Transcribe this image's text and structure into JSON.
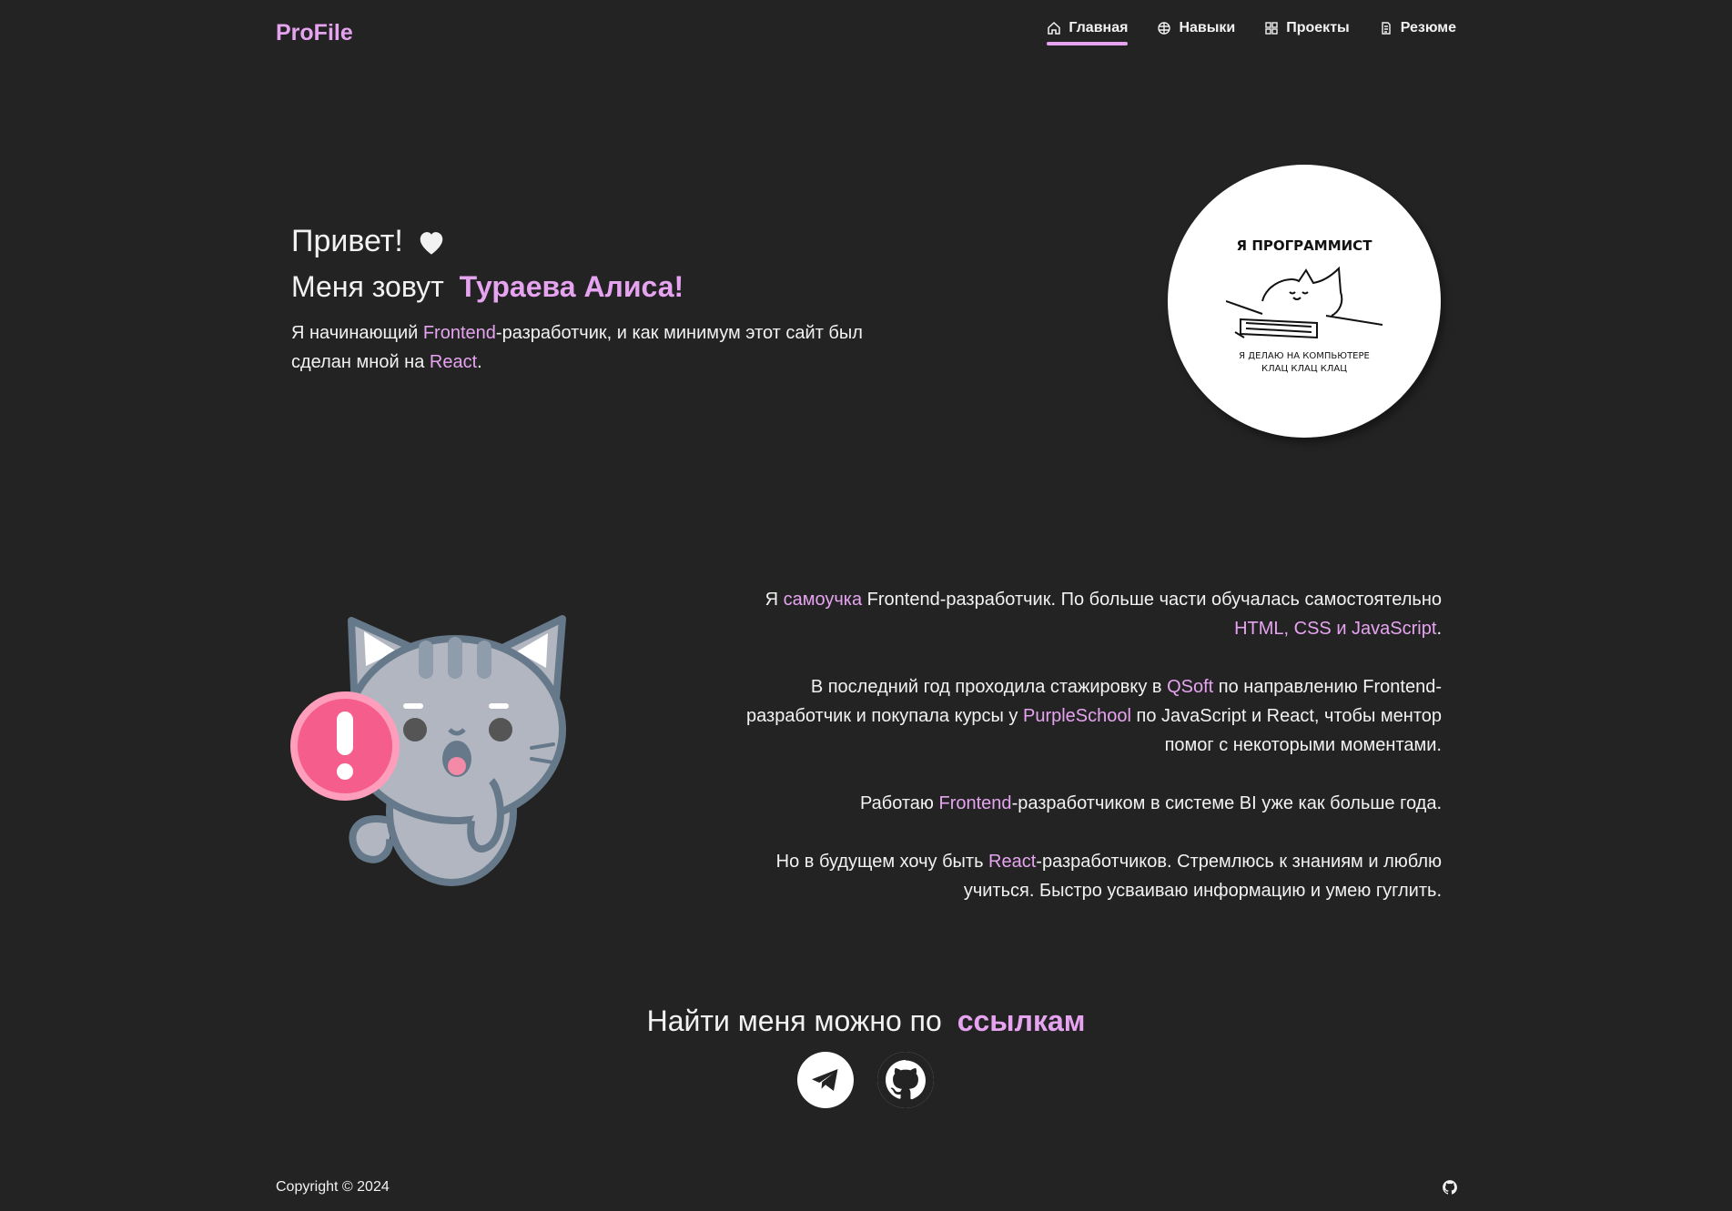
{
  "nav": {
    "brand": "ProFile",
    "links": [
      {
        "label": "Главная",
        "icon": "home-icon",
        "active": true
      },
      {
        "label": "Навыки",
        "icon": "skills-icon"
      },
      {
        "label": "Проекты",
        "icon": "grid-icon"
      },
      {
        "label": "Резюме",
        "icon": "document-icon"
      }
    ]
  },
  "hero": {
    "greeting": "Привет!",
    "name_prefix": "Меня зовут",
    "name": "Тураева Алиса!",
    "desc_1": "Я начинающий ",
    "desc_frontend": "Frontend",
    "desc_2": "-разработчик, и как минимум этот сайт был сделан мной на ",
    "desc_react": "React",
    "desc_3": ".",
    "avatar_top": "Я ПРОГРАММИСТ",
    "avatar_bottom_1": "Я ДЕЛАЮ НА КОМПЬЮТЕРЕ",
    "avatar_bottom_2": "КЛАЦ КЛАЦ КЛАЦ"
  },
  "about": {
    "p1_a": "Я ",
    "p1_accent": "самоучка",
    "p1_b": " Frontend-разработчик. По больше части обучалась самостоятельно ",
    "p1_accent2": "HTML, CSS и JavaScript",
    "p1_c": ".",
    "p2_a": "В последний год проходила стажировку в ",
    "p2_qsoft": "QSoft",
    "p2_b": " по направлению Frontend-разработчик и покупала курсы у ",
    "p2_purple": "PurpleSchool",
    "p2_c": " по JavaScript и React, чтобы ментор помог с некоторыми моментами.",
    "p3_a": "Работаю ",
    "p3_accent": "Frontend",
    "p3_b": "-разработчиком в системе BI уже как больше года.",
    "p4_a": "Но в будущем хочу быть ",
    "p4_accent": "React",
    "p4_b": "-разработчиков. Стремлюсь к знаниям и люблю учиться. Быстро усваиваю информацию и умею гуглить."
  },
  "links": {
    "title": "Найти меня можно по",
    "title_accent": "ссылкам",
    "items": [
      {
        "icon": "telegram-icon"
      },
      {
        "icon": "github-icon"
      }
    ]
  },
  "footer": {
    "copyright": "Copyright © 2024",
    "icon": "github-icon"
  },
  "colors": {
    "background": "#232323",
    "accent": "#e6a4f0",
    "text": "#f2f2f2"
  }
}
